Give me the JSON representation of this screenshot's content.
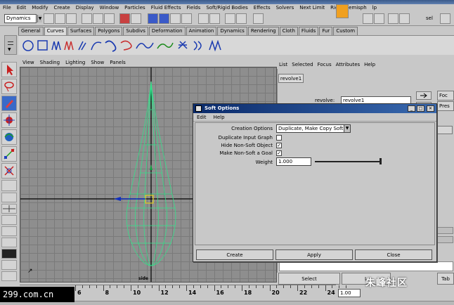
{
  "menubar": [
    "File",
    "Edit",
    "Modify",
    "Create",
    "Display",
    "Window",
    "Particles",
    "Fluid Effects",
    "Fields",
    "Soft/Rigid Bodies",
    "Effects",
    "Solvers",
    "Next Limit",
    "Right Hemisph",
    "lp"
  ],
  "status": {
    "mode": "Dynamics",
    "sel_label": "sel"
  },
  "shelf_tabs": [
    "General",
    "Curves",
    "Surfaces",
    "Polygons",
    "Subdivs",
    "Deformation",
    "Animation",
    "Dynamics",
    "Rendering",
    "Cloth",
    "Fluids",
    "Fur",
    "Custom"
  ],
  "shelf_active": "Curves",
  "viewport": {
    "menu": [
      "View",
      "Shading",
      "Lighting",
      "Show",
      "Panels"
    ],
    "camera_label": "side"
  },
  "attribute_editor": {
    "menu": [
      "List",
      "Selected",
      "Focus",
      "Attributes",
      "Help"
    ],
    "tab": "revolve1",
    "field_label": "revolve:",
    "field_value": "revolve1",
    "focus_label": "Foc",
    "presets_label": "Pres",
    "bottom_buttons": [
      "Select",
      "L",
      "Tab"
    ]
  },
  "dialog": {
    "title": "Soft Options",
    "menu": [
      "Edit",
      "Help"
    ],
    "creation_options_label": "Creation Options",
    "creation_options_value": "Duplicate, Make Copy Soft",
    "duplicate_input_graph_label": "Duplicate Input Graph",
    "duplicate_input_graph_checked": false,
    "hide_non_soft_label": "Hide Non-Soft Object",
    "hide_non_soft_checked": true,
    "make_goal_label": "Make Non-Soft a Goal",
    "make_goal_checked": true,
    "weight_label": "Weight",
    "weight_value": "1.000",
    "weight_slider": 1.0,
    "buttons": {
      "create": "Create",
      "apply": "Apply",
      "close": "Close"
    }
  },
  "timeline": {
    "ticks": [
      "6",
      "8",
      "10",
      "12",
      "14",
      "16",
      "18",
      "20",
      "22",
      "24"
    ],
    "current_time": "1.00"
  },
  "watermarks": {
    "left": "299.com.cn",
    "right": "朱峰社区"
  }
}
